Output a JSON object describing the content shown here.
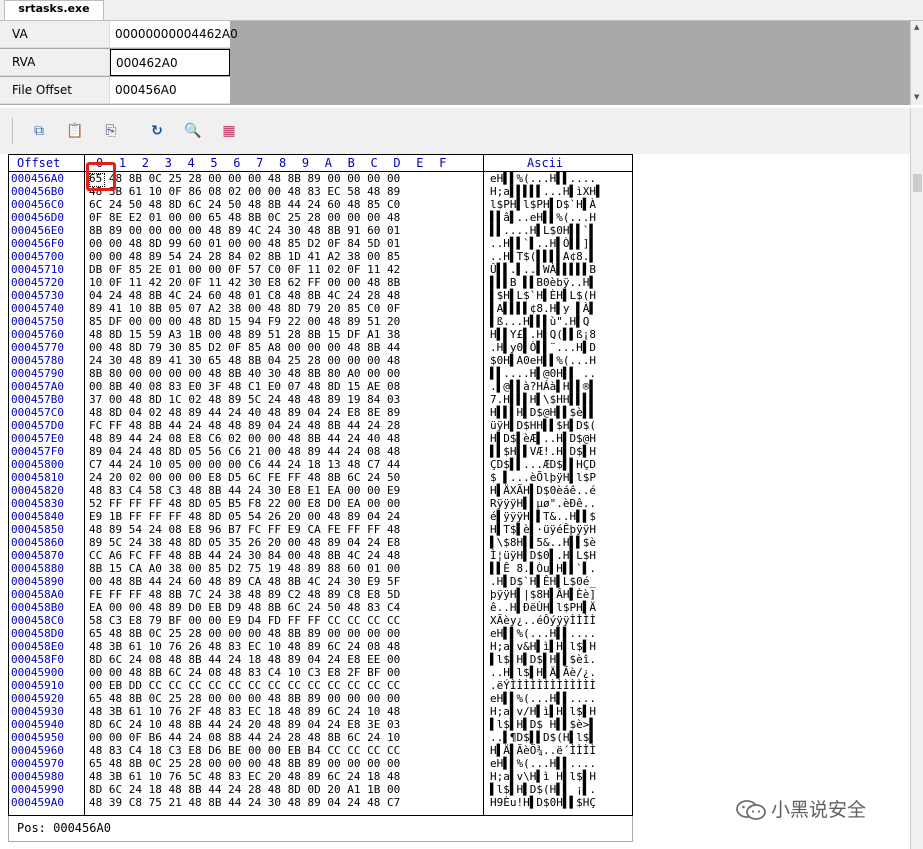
{
  "tab": {
    "title": "srtasks.exe"
  },
  "address": [
    {
      "label": "VA",
      "value": "00000000004462A0"
    },
    {
      "label": "RVA",
      "value": "000462A0"
    },
    {
      "label": "File Offset",
      "value": "000456A0"
    }
  ],
  "toolbar": {
    "buttons": [
      {
        "name": "copy-icon",
        "glyph": "⧉"
      },
      {
        "name": "paste-icon",
        "glyph": "📋"
      },
      {
        "name": "copy-hex-icon",
        "glyph": "⎘"
      },
      {
        "name": "refresh-icon",
        "glyph": "↻"
      },
      {
        "name": "search-icon",
        "glyph": "🔍"
      },
      {
        "name": "bytes-icon",
        "glyph": "▦"
      }
    ]
  },
  "hex": {
    "offset_header": "Offset",
    "column_header": "0  1  2  3  4  5  6  7  8  9  A  B  C  D  E  F",
    "ascii_header": "Ascii",
    "rows": [
      {
        "o": "000456A0",
        "h": "65 48 8B 0C 25 28 00 00 00 48 8B 89 00 00 00 00",
        "a": "eH▌▌%(...H▌▌...."
      },
      {
        "o": "000456B0",
        "h": "48 3B 61 10 0F 86 08 02 00 00 48 83 EC 58 48 89",
        "a": "H;a▌▌▌▌▌...H▌ìXH▌"
      },
      {
        "o": "000456C0",
        "h": "6C 24 50 48 8D 6C 24 50 48 8B 44 24 60 48 85 C0",
        "a": "l$PH▌l$PH▌D$`H▌À"
      },
      {
        "o": "000456D0",
        "h": "0F 8E E2 01 00 00 65 48 8B 0C 25 28 00 00 00 48",
        "a": "▌▌â▌..eH▌▌%(...H"
      },
      {
        "o": "000456E0",
        "h": "8B 89 00 00 00 00 48 89 4C 24 30 48 8B 91 60 01",
        "a": "▌▌....H▌L$0H▌▌`▌"
      },
      {
        "o": "000456F0",
        "h": "00 00 48 8D 99 60 01 00 00 48 85 D2 0F 84 5D 01",
        "a": "..H▌▌`▌..H▌Ò▌▌]▌"
      },
      {
        "o": "00045700",
        "h": "00 00 48 89 54 24 28 84 02 8B 1D 41 A2 38 00 85",
        "a": "..H▌T$(▌▌▌▌A¢8.▌"
      },
      {
        "o": "00045710",
        "h": "DB 0F 85 2E 01 00 00 0F 57 C0 0F 11 02 0F 11 42",
        "a": "Û▌▌.▌..▌WÀ▌▌▌▌▌B"
      },
      {
        "o": "00045720",
        "h": "10 0F 11 42 20 0F 11 42 30 E8 62 FF 00 00 48 8B",
        "a": "▌▌▌B ▌▌B0èbÿ..H▌"
      },
      {
        "o": "00045730",
        "h": "04 24 48 8B 4C 24 60 48 01 C8 48 8B 4C 24 28 48",
        "a": "▌$H▌L$`H▌ÈH▌L$(H"
      },
      {
        "o": "00045740",
        "h": "89 41 10 8B 05 07 A2 38 00 48 8D 79 20 85 C0 0F",
        "a": "▌A▌▌▌▌¢8.H▌y ▌À▌"
      },
      {
        "o": "00045750",
        "h": "85 DF 00 00 00 48 8D 15 94 F9 22 00 48 89 51 20",
        "a": "▌ß...H▌▌▌ù\".H▌Q "
      },
      {
        "o": "00045760",
        "h": "48 8D 15 59 A3 1B 00 48 89 51 28 8B 15 DF A1 38",
        "a": "H▌▌Y£▌.H▌Q(▌▌ß¡8"
      },
      {
        "o": "00045770",
        "h": "00 48 8D 79 30 85 D2 0F 85 A8 00 00 00 48 8B 44",
        "a": ".H▌y0▌Ò▌▌¨...H▌D"
      },
      {
        "o": "00045780",
        "h": "24 30 48 89 41 30 65 48 8B 04 25 28 00 00 00 48",
        "a": "$0H▌A0eH▌▌%(...H"
      },
      {
        "o": "00045790",
        "h": "8B 80 00 00 00 00 48 8B 40 30 48 8B 80 A0 00 00",
        "a": "▌▌....H▌@0H▌▌ .."
      },
      {
        "o": "000457A0",
        "h": "00 8B 40 08 83 E0 3F 48 C1 E0 07 48 8D 15 AE 08",
        "a": ".▌@▌▌à?HÁà▌H▌▌®▌"
      },
      {
        "o": "000457B0",
        "h": "37 00 48 8D 1C 02 48 89 5C 24 48 48 89 19 84 03",
        "a": "7.H▌▌▌H▌\\$HH▌▌▌▌"
      },
      {
        "o": "000457C0",
        "h": "48 8D 04 02 48 89 44 24 40 48 89 04 24 E8 8E 89",
        "a": "H▌▌▌H▌D$@H▌▌$è▌▌"
      },
      {
        "o": "000457D0",
        "h": "FC FF 48 8B 44 24 48 48 89 04 24 48 8B 44 24 28",
        "a": "üÿH▌D$HH▌▌$H▌D$("
      },
      {
        "o": "000457E0",
        "h": "48 89 44 24 08 E8 C6 02 00 00 48 8B 44 24 40 48",
        "a": "H▌D$▌èÆ▌..H▌D$@H"
      },
      {
        "o": "000457F0",
        "h": "89 04 24 48 8D 05 56 C6 21 00 48 89 44 24 08 48",
        "a": "▌▌$H▌▌VÆ!.H▌D$▌H"
      },
      {
        "o": "00045800",
        "h": "C7 44 24 10 05 00 00 00 C6 44 24 18 13 48 C7 44",
        "a": "ÇD$▌▌...ÆD$▌▌HÇD"
      },
      {
        "o": "00045810",
        "h": "24 20 02 00 00 00 E8 D5 6C FE FF 48 8B 6C 24 50",
        "a": "$ ▌...èÕlþÿH▌l$P"
      },
      {
        "o": "00045820",
        "h": "48 83 C4 58 C3 48 8B 44 24 30 E8 E1 EA 00 00 E9",
        "a": "H▌ÄXÃH▌D$0èáê..é"
      },
      {
        "o": "00045830",
        "h": "52 FF FF FF 48 8D 05 B5 F8 22 00 E8 D0 EA 00 00",
        "a": "RÿÿÿH▌▌µø\".èÐê.."
      },
      {
        "o": "00045840",
        "h": "E9 1B FF FF FF 48 8D 05 54 26 20 00 48 89 04 24",
        "a": "é▌ÿÿÿH▌▌T&..H▌▌$"
      },
      {
        "o": "00045850",
        "h": "48 89 54 24 08 E8 96 B7 FC FF E9 CA FE FF FF 48",
        "a": "H▌T$▌è▌·üÿéÊþÿÿH"
      },
      {
        "o": "00045860",
        "h": "89 5C 24 38 48 8D 05 35 26 20 00 48 89 04 24 E8",
        "a": "▌\\$8H▌▌5&..H▌▌$è"
      },
      {
        "o": "00045870",
        "h": "CC A6 FC FF 48 8B 44 24 30 84 00 48 8B 4C 24 48",
        "a": "Ì¦üÿH▌D$0▌.H▌L$H"
      },
      {
        "o": "00045880",
        "h": "8B 15 CA A0 38 00 85 D2 75 19 48 89 88 60 01 00",
        "a": "▌▌Ê 8.▌Òu▌H▌▌`▌."
      },
      {
        "o": "00045890",
        "h": "00 48 8B 44 24 60 48 89 CA 48 8B 4C 24 30 E9 5F",
        "a": ".H▌D$`H▌ÊH▌L$0é_"
      },
      {
        "o": "000458A0",
        "h": "FE FF FF 48 8B 7C 24 38 48 89 C2 48 89 C8 E8 5D",
        "a": "þÿÿH▌|$8H▌ÂH▌Èè]"
      },
      {
        "o": "000458B0",
        "h": "EA 00 00 48 89 D0 EB D9 48 8B 6C 24 50 48 83 C4",
        "a": "ê..H▌ÐëÙH▌l$PH▌Ä"
      },
      {
        "o": "000458C0",
        "h": "58 C3 E8 79 BF 00 00 E9 D4 FD FF FF CC CC CC CC",
        "a": "XÃèy¿..éÔýÿÿÌÌÌÌ"
      },
      {
        "o": "000458D0",
        "h": "65 48 8B 0C 25 28 00 00 00 48 8B 89 00 00 00 00",
        "a": "eH▌▌%(...H▌▌...."
      },
      {
        "o": "000458E0",
        "h": "48 3B 61 10 76 26 48 83 EC 10 48 89 6C 24 08 48",
        "a": "H;a▌v&H▌ì▌H▌l$▌H"
      },
      {
        "o": "000458F0",
        "h": "8D 6C 24 08 48 8B 44 24 18 48 89 04 24 E8 EE 00",
        "a": "▌l$▌H▌D$▌H▌▌$èî."
      },
      {
        "o": "00045900",
        "h": "00 00 48 8B 6C 24 08 48 83 C4 10 C3 E8 2F BF 00",
        "a": "..H▌l$▌H▌Ä▌Ãè/¿."
      },
      {
        "o": "00045910",
        "h": "00 EB DD CC CC CC CC CC CC CC CC CC CC CC CC CC",
        "a": ".ëÝÌÌÌÌÌÌÌÌÌÌÌÌÌ"
      },
      {
        "o": "00045920",
        "h": "65 48 8B 0C 25 28 00 00 00 48 8B 89 00 00 00 00",
        "a": "eH▌▌%(...H▌▌...."
      },
      {
        "o": "00045930",
        "h": "48 3B 61 10 76 2F 48 83 EC 18 48 89 6C 24 10 48",
        "a": "H;a▌v/H▌ì▌H▌l$▌H"
      },
      {
        "o": "00045940",
        "h": "8D 6C 24 10 48 8B 44 24 20 48 89 04 24 E8 3E 03",
        "a": "▌l$▌H▌D$ H▌▌$è>▌"
      },
      {
        "o": "00045950",
        "h": "00 00 0F B6 44 24 08 88 44 24 28 48 8B 6C 24 10",
        "a": "..▌¶D$▌▌D$(H▌l$▌"
      },
      {
        "o": "00045960",
        "h": "48 83 C4 18 C3 E8 D6 BE 00 00 EB B4 CC CC CC CC",
        "a": "H▌Ä▌ÃèÖ¾..ë´ÌÌÌÌ"
      },
      {
        "o": "00045970",
        "h": "65 48 8B 0C 25 28 00 00 00 48 8B 89 00 00 00 00",
        "a": "eH▌▌%(...H▌▌...."
      },
      {
        "o": "00045980",
        "h": "48 3B 61 10 76 5C 48 83 EC 20 48 89 6C 24 18 48",
        "a": "H;a▌v\\H▌ì H▌l$▌H"
      },
      {
        "o": "00045990",
        "h": "8D 6C 24 18 48 8B 44 24 28 48 8D 0D 20 A1 1B 00",
        "a": "▌l$▌H▌D$(H▌▌ ¡▌."
      },
      {
        "o": "000459A0",
        "h": "48 39 C8 75 21 48 8B 44 24 30 48 89 04 24 48 C7",
        "a": "H9Èu!H▌D$0H▌▌$HÇ"
      }
    ]
  },
  "status": {
    "text": "Pos: 000456A0"
  },
  "watermark": {
    "text": "小黑说安全"
  }
}
